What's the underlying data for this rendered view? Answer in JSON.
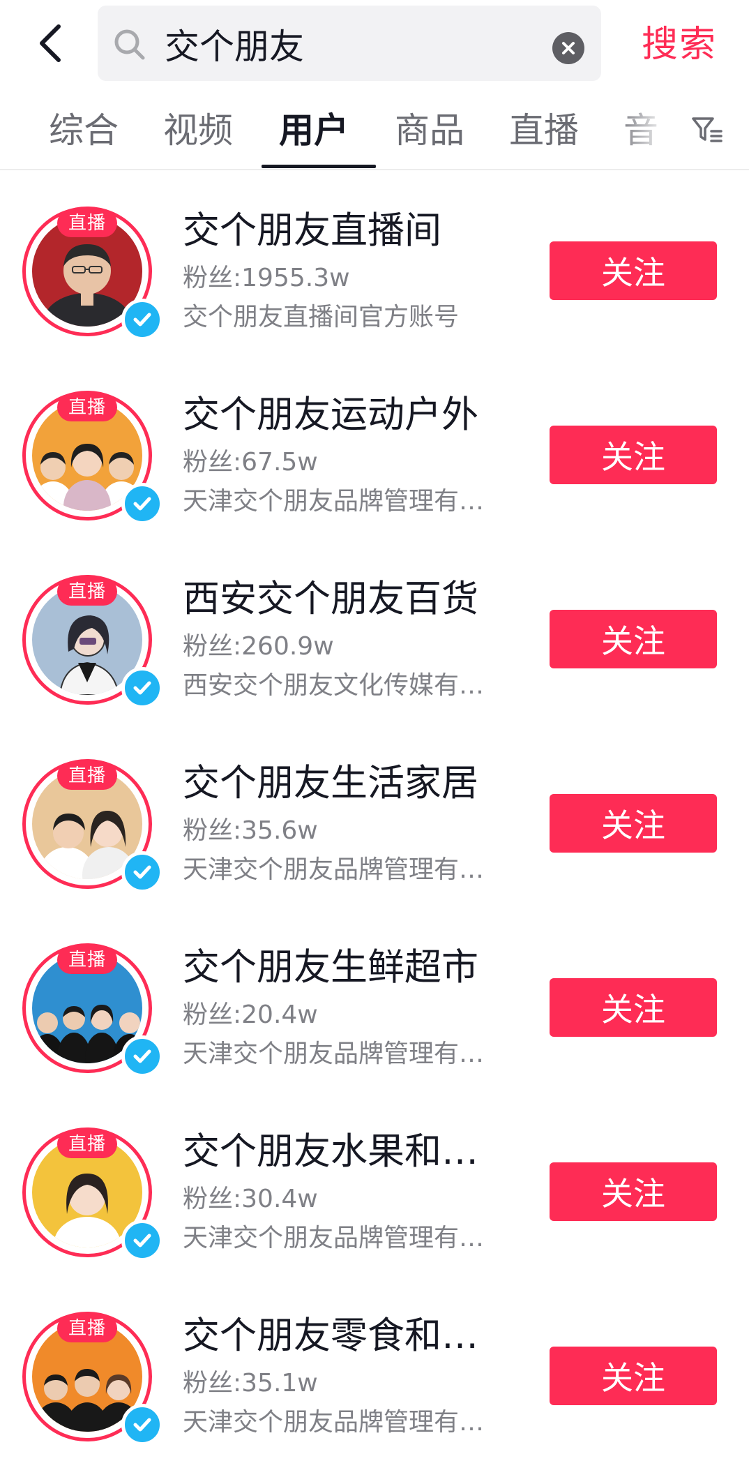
{
  "header": {
    "query": "交个朋友",
    "search_label": "搜索"
  },
  "tabs": [
    {
      "label": "综合",
      "active": false
    },
    {
      "label": "视频",
      "active": false
    },
    {
      "label": "用户",
      "active": true
    },
    {
      "label": "商品",
      "active": false
    },
    {
      "label": "直播",
      "active": false
    },
    {
      "label": "音",
      "active": false
    }
  ],
  "icons": {
    "back": "back-arrow-icon",
    "search": "search-icon",
    "clear": "clear-icon",
    "filter": "filter-icon",
    "verified": "verified-icon"
  },
  "colors": {
    "accent": "#fe2c55",
    "verified": "#20b5f4",
    "text_primary": "#161823",
    "text_secondary": "#7f8086"
  },
  "users": [
    {
      "name": "交个朋友直播间",
      "fans_label": "粉丝:",
      "fans": "1955.3w",
      "desc": "交个朋友直播间官方账号",
      "live_badge": "直播",
      "follow_label": "关注",
      "avatar_bg": "#b3262b"
    },
    {
      "name": "交个朋友运动户外",
      "fans_label": "粉丝:",
      "fans": "67.5w",
      "desc": "天津交个朋友品牌管理有…",
      "live_badge": "直播",
      "follow_label": "关注",
      "avatar_bg": "#f2a23a"
    },
    {
      "name": "西安交个朋友百货",
      "fans_label": "粉丝:",
      "fans": "260.9w",
      "desc": "西安交个朋友文化传媒有…",
      "live_badge": "直播",
      "follow_label": "关注",
      "avatar_bg": "#a9bfd6"
    },
    {
      "name": "交个朋友生活家居",
      "fans_label": "粉丝:",
      "fans": "35.6w",
      "desc": "天津交个朋友品牌管理有…",
      "live_badge": "直播",
      "follow_label": "关注",
      "avatar_bg": "#e9c79a"
    },
    {
      "name": "交个朋友生鲜超市",
      "fans_label": "粉丝:",
      "fans": "20.4w",
      "desc": "天津交个朋友品牌管理有…",
      "live_badge": "直播",
      "follow_label": "关注",
      "avatar_bg": "#2f8fd0"
    },
    {
      "name": "交个朋友水果和…",
      "fans_label": "粉丝:",
      "fans": "30.4w",
      "desc": "天津交个朋友品牌管理有…",
      "live_badge": "直播",
      "follow_label": "关注",
      "avatar_bg": "#f3c33c"
    },
    {
      "name": "交个朋友零食和…",
      "fans_label": "粉丝:",
      "fans": "35.1w",
      "desc": "天津交个朋友品牌管理有…",
      "live_badge": "直播",
      "follow_label": "关注",
      "avatar_bg": "#f08a2a"
    }
  ]
}
